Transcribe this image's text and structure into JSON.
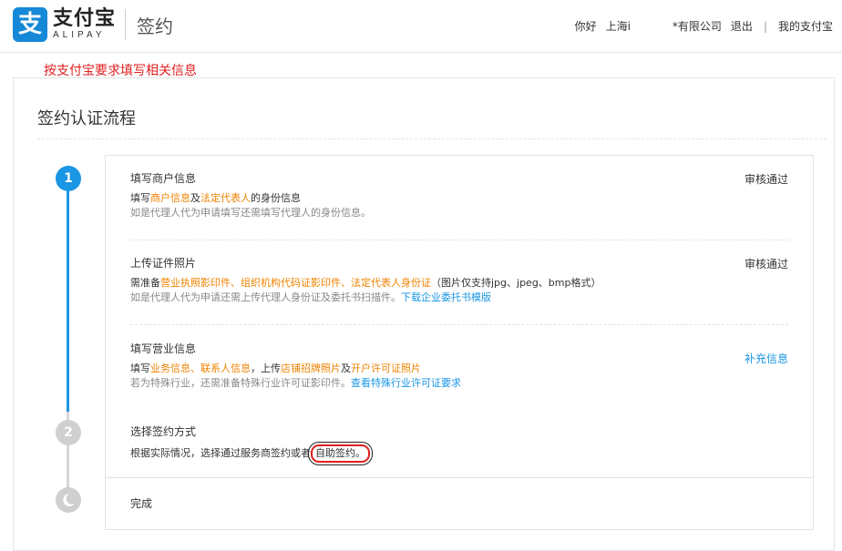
{
  "header": {
    "logo_glyph": "支",
    "logo_cn": "支付宝",
    "logo_en": "ALIPAY",
    "page_name": "签约",
    "nav": {
      "greeting": "你好",
      "location": "上海i",
      "company": "*有限公司",
      "logout": "退出",
      "separator": "|",
      "my_alipay": "我的支付宝"
    }
  },
  "hint": "按支付宝要求填写相关信息",
  "process": {
    "title": "签约认证流程",
    "steps": [
      {
        "marker": "1",
        "items": [
          {
            "title": "填写商户信息",
            "status": "审核通过",
            "line": [
              "填写",
              "商户信息",
              "及",
              "法定代表人",
              "的身份信息"
            ],
            "note": "如是代理人代为申请填写还需填写代理人的身份信息。"
          },
          {
            "title": "上传证件照片",
            "status": "审核通过",
            "line": [
              "需准备",
              "营业执照影印件、组织机构代码证影印件、法定代表人身份证",
              "（图片仅支持jpg、jpeg、bmp格式）"
            ],
            "note": "如是代理人代为申请还需上传代理人身份证及委托书扫描件。",
            "note_link": "下载企业委托书模版"
          },
          {
            "title": "填写营业信息",
            "status": "补充信息",
            "line": [
              "填写",
              "业务信息、联系人信息",
              "，上传",
              "店铺招牌照片",
              "及",
              "开户许可证照片"
            ],
            "note": "若为特殊行业，还需准备特殊行业许可证影印件。",
            "note_link": "查看特殊行业许可证要求"
          }
        ]
      },
      {
        "marker": "2",
        "title": "选择签约方式",
        "line_prefix": "根据实际情况，选择通过服务商签约或者",
        "line_highlight": "自助签约。"
      },
      {
        "marker": "3",
        "title": "完成"
      }
    ]
  },
  "colors": {
    "accent_blue": "#1a96e4",
    "orange": "#f08300",
    "hint_red": "#e02020",
    "inactive_gray": "#cfcfcf"
  }
}
